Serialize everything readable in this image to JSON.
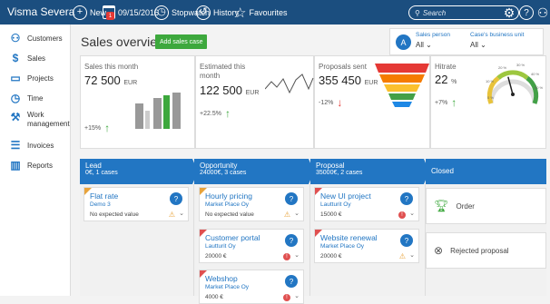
{
  "topbar": {
    "brand": "Visma Severa",
    "new_label": "New",
    "calendar_badge": "1",
    "date_label": "09/15/2016",
    "stopwatch_label": "Stopwatch",
    "history_label": "History",
    "favourites_label": "Favourites",
    "search_placeholder": "Search"
  },
  "sidebar": {
    "items": [
      {
        "label": "Customers",
        "icon": "person-icon"
      },
      {
        "label": "Sales",
        "icon": "dollar-icon"
      },
      {
        "label": "Projects",
        "icon": "folder-icon"
      },
      {
        "label": "Time",
        "icon": "clock-icon"
      },
      {
        "label": "Work management",
        "icon": "work-management-icon"
      },
      {
        "label": "Invoices",
        "icon": "invoice-icon"
      },
      {
        "label": "Reports",
        "icon": "report-chart-icon"
      }
    ]
  },
  "page": {
    "title": "Sales overview",
    "add_button": "Add sales case"
  },
  "filters": {
    "avatar": "A",
    "sales_person_label": "Sales person",
    "sales_person_value": "All",
    "business_unit_label": "Case's business unit",
    "business_unit_value": "All"
  },
  "kpis": {
    "sales_month": {
      "label": "Sales this month",
      "value": "72 500",
      "unit": "EUR",
      "change": "+15%"
    },
    "estimated": {
      "label": "Estimated this month",
      "value": "122 500",
      "unit": "EUR",
      "change": "+22.5%"
    },
    "proposals": {
      "label": "Proposals sent",
      "value": "355 450",
      "unit": "EUR",
      "change": "-12%"
    },
    "hitrate": {
      "label": "Hitrate",
      "value": "22",
      "unit": "%",
      "change": "+7%",
      "gauge_ticks": [
        "0 %",
        "10 %",
        "20 %",
        "30 %",
        "40 %",
        "50 %"
      ],
      "gauge_level": 0.22
    }
  },
  "columns": [
    {
      "title": "Lead",
      "sub": "0€, 1 cases"
    },
    {
      "title": "Opportunity",
      "sub": "24000€, 3 cases"
    },
    {
      "title": "Proposal",
      "sub": "35000€, 2 cases"
    },
    {
      "title": "Closed",
      "sub": ""
    }
  ],
  "cards": {
    "flat_rate": {
      "title": "Flat rate",
      "sub": "Demo 3",
      "value": "No expected value"
    },
    "hourly": {
      "title": "Hourly pricing",
      "sub": "Market Place Oy",
      "value": "No expected value"
    },
    "portal": {
      "title": "Customer portal",
      "sub": "Lautturit Oy",
      "value": "20000 €"
    },
    "webshop": {
      "title": "Webshop",
      "sub": "Market Place Oy",
      "value": "4000 €"
    },
    "ui_project": {
      "title": "New UI project",
      "sub": "Lautturit Oy",
      "value": "15000 €"
    },
    "website": {
      "title": "Website renewal",
      "sub": "Market Place Oy",
      "value": "20000 €"
    }
  },
  "closed": {
    "order_label": "Order",
    "rejected_label": "Rejected proposal"
  },
  "colors": {
    "topbar": "#1b4e7f",
    "accent": "#2276c3",
    "add_button": "#3da83d",
    "warning": "#e8a33b",
    "alert": "#e05050"
  }
}
